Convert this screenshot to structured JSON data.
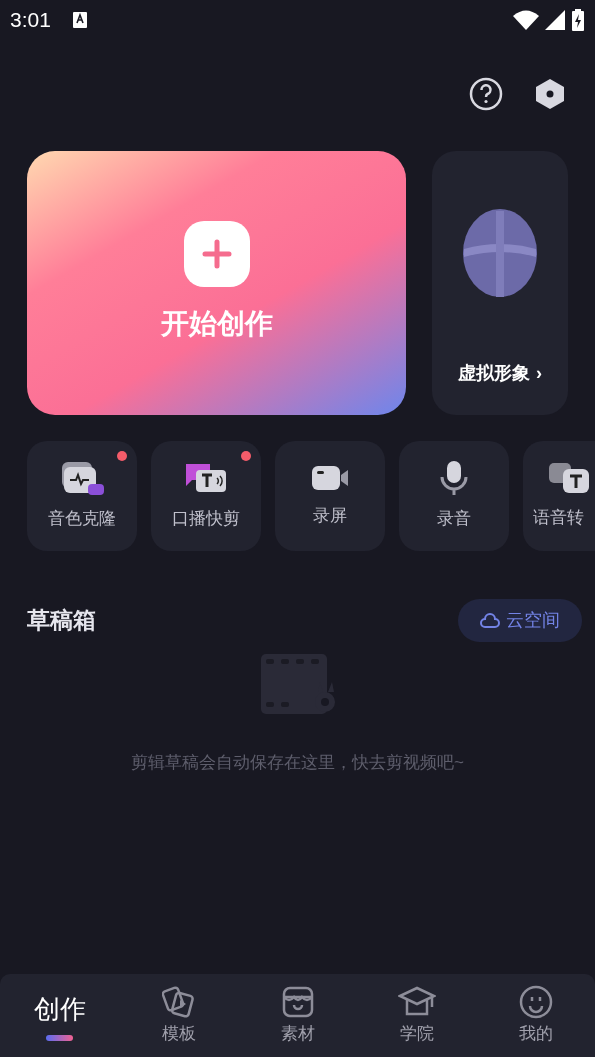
{
  "status_bar": {
    "time": "3:01"
  },
  "create_card": {
    "label": "开始创作"
  },
  "avatar_card": {
    "label": "虚拟形象",
    "chevron": "›"
  },
  "tools": [
    {
      "label": "音色克隆",
      "kind": "voice-clone",
      "dot": true
    },
    {
      "label": "口播快剪",
      "kind": "talk-cut",
      "dot": true
    },
    {
      "label": "录屏",
      "kind": "screen-record",
      "dot": false
    },
    {
      "label": "录音",
      "kind": "record",
      "dot": false
    },
    {
      "label": "语音转",
      "kind": "speech-text",
      "dot": false
    }
  ],
  "drafts": {
    "title": "草稿箱",
    "cloud_button": "云空间",
    "empty_text": "剪辑草稿会自动保存在这里，快去剪视频吧~"
  },
  "tabs": [
    {
      "label": "创作",
      "selected": true
    },
    {
      "label": "模板",
      "kind": "template",
      "selected": false
    },
    {
      "label": "素材",
      "kind": "material",
      "selected": false
    },
    {
      "label": "学院",
      "kind": "academy",
      "selected": false
    },
    {
      "label": "我的",
      "kind": "me",
      "selected": false
    }
  ]
}
